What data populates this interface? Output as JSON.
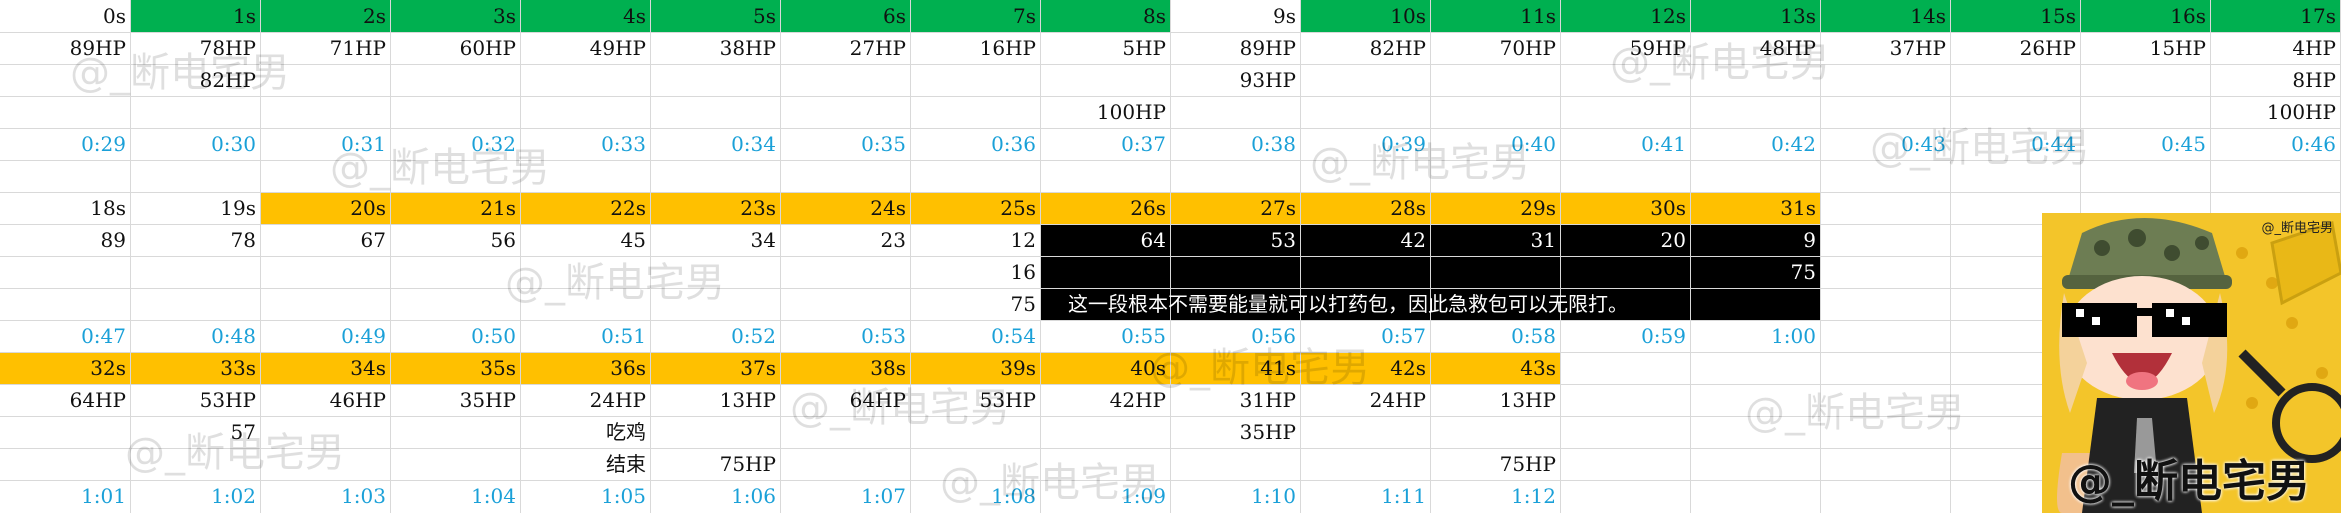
{
  "sheet": {
    "time_color": "#1aa0d8",
    "green": "#00b050",
    "orange": "#ffc000",
    "black": "#000000",
    "rows": [
      [
        {
          "c": 0,
          "t": "0s"
        },
        {
          "c": 1,
          "t": "1s"
        },
        {
          "c": 2,
          "t": "2s"
        },
        {
          "c": 3,
          "t": "3s"
        },
        {
          "c": 4,
          "t": "4s"
        },
        {
          "c": 5,
          "t": "5s"
        },
        {
          "c": 6,
          "t": "6s"
        },
        {
          "c": 7,
          "t": "7s"
        },
        {
          "c": 8,
          "t": "8s"
        },
        {
          "c": 9,
          "t": "9s"
        },
        {
          "c": 10,
          "t": "10s"
        },
        {
          "c": 11,
          "t": "11s"
        },
        {
          "c": 12,
          "t": "12s"
        },
        {
          "c": 13,
          "t": "13s"
        },
        {
          "c": 14,
          "t": "14s"
        },
        {
          "c": 15,
          "t": "15s"
        },
        {
          "c": 16,
          "t": "16s"
        },
        {
          "c": 17,
          "t": "17s"
        }
      ],
      [
        {
          "c": 0,
          "t": "89HP"
        },
        {
          "c": 1,
          "t": "78HP"
        },
        {
          "c": 2,
          "t": "71HP"
        },
        {
          "c": 3,
          "t": "60HP"
        },
        {
          "c": 4,
          "t": "49HP"
        },
        {
          "c": 5,
          "t": "38HP"
        },
        {
          "c": 6,
          "t": "27HP"
        },
        {
          "c": 7,
          "t": "16HP"
        },
        {
          "c": 8,
          "t": "5HP"
        },
        {
          "c": 9,
          "t": "89HP"
        },
        {
          "c": 10,
          "t": "82HP"
        },
        {
          "c": 11,
          "t": "70HP"
        },
        {
          "c": 12,
          "t": "59HP"
        },
        {
          "c": 13,
          "t": "48HP"
        },
        {
          "c": 14,
          "t": "37HP"
        },
        {
          "c": 15,
          "t": "26HP"
        },
        {
          "c": 16,
          "t": "15HP"
        },
        {
          "c": 17,
          "t": "4HP"
        }
      ],
      [
        {
          "c": 1,
          "t": "82HP"
        },
        {
          "c": 9,
          "t": "93HP"
        },
        {
          "c": 17,
          "t": "8HP"
        }
      ],
      [
        {
          "c": 8,
          "t": "100HP"
        },
        {
          "c": 17,
          "t": "100HP"
        }
      ],
      [
        {
          "c": 0,
          "t": "0:29",
          "time": true
        },
        {
          "c": 1,
          "t": "0:30",
          "time": true
        },
        {
          "c": 2,
          "t": "0:31",
          "time": true
        },
        {
          "c": 3,
          "t": "0:32",
          "time": true
        },
        {
          "c": 4,
          "t": "0:33",
          "time": true
        },
        {
          "c": 5,
          "t": "0:34",
          "time": true
        },
        {
          "c": 6,
          "t": "0:35",
          "time": true
        },
        {
          "c": 7,
          "t": "0:36",
          "time": true
        },
        {
          "c": 8,
          "t": "0:37",
          "time": true
        },
        {
          "c": 9,
          "t": "0:38",
          "time": true
        },
        {
          "c": 10,
          "t": "0:39",
          "time": true
        },
        {
          "c": 11,
          "t": "0:40",
          "time": true
        },
        {
          "c": 12,
          "t": "0:41",
          "time": true
        },
        {
          "c": 13,
          "t": "0:42",
          "time": true
        },
        {
          "c": 14,
          "t": "0:43",
          "time": true
        },
        {
          "c": 15,
          "t": "0:44",
          "time": true
        },
        {
          "c": 16,
          "t": "0:45",
          "time": true
        },
        {
          "c": 17,
          "t": "0:46",
          "time": true
        }
      ],
      [],
      [
        {
          "c": 0,
          "t": "18s"
        },
        {
          "c": 1,
          "t": "19s"
        },
        {
          "c": 2,
          "t": "20s"
        },
        {
          "c": 3,
          "t": "21s"
        },
        {
          "c": 4,
          "t": "22s"
        },
        {
          "c": 5,
          "t": "23s"
        },
        {
          "c": 6,
          "t": "24s"
        },
        {
          "c": 7,
          "t": "25s"
        },
        {
          "c": 8,
          "t": "26s"
        },
        {
          "c": 9,
          "t": "27s"
        },
        {
          "c": 10,
          "t": "28s"
        },
        {
          "c": 11,
          "t": "29s"
        },
        {
          "c": 12,
          "t": "30s"
        },
        {
          "c": 13,
          "t": "31s"
        }
      ],
      [
        {
          "c": 0,
          "t": "89"
        },
        {
          "c": 1,
          "t": "78"
        },
        {
          "c": 2,
          "t": "67"
        },
        {
          "c": 3,
          "t": "56"
        },
        {
          "c": 4,
          "t": "45"
        },
        {
          "c": 5,
          "t": "34"
        },
        {
          "c": 6,
          "t": "23"
        },
        {
          "c": 7,
          "t": "12"
        },
        {
          "c": 8,
          "t": "64"
        },
        {
          "c": 9,
          "t": "53"
        },
        {
          "c": 10,
          "t": "42"
        },
        {
          "c": 11,
          "t": "31"
        },
        {
          "c": 12,
          "t": "20"
        },
        {
          "c": 13,
          "t": "9"
        }
      ],
      [
        {
          "c": 7,
          "t": "16"
        },
        {
          "c": 13,
          "t": "75"
        }
      ],
      [
        {
          "c": 7,
          "t": "75"
        }
      ],
      [
        {
          "c": 0,
          "t": "0:47",
          "time": true
        },
        {
          "c": 1,
          "t": "0:48",
          "time": true
        },
        {
          "c": 2,
          "t": "0:49",
          "time": true
        },
        {
          "c": 3,
          "t": "0:50",
          "time": true
        },
        {
          "c": 4,
          "t": "0:51",
          "time": true
        },
        {
          "c": 5,
          "t": "0:52",
          "time": true
        },
        {
          "c": 6,
          "t": "0:53",
          "time": true
        },
        {
          "c": 7,
          "t": "0:54",
          "time": true
        },
        {
          "c": 8,
          "t": "0:55",
          "time": true
        },
        {
          "c": 9,
          "t": "0:56",
          "time": true
        },
        {
          "c": 10,
          "t": "0:57",
          "time": true
        },
        {
          "c": 11,
          "t": "0:58",
          "time": true
        },
        {
          "c": 12,
          "t": "0:59",
          "time": true
        },
        {
          "c": 13,
          "t": "1:00",
          "time": true
        }
      ],
      [
        {
          "c": 0,
          "t": "32s"
        },
        {
          "c": 1,
          "t": "33s"
        },
        {
          "c": 2,
          "t": "34s"
        },
        {
          "c": 3,
          "t": "35s"
        },
        {
          "c": 4,
          "t": "36s"
        },
        {
          "c": 5,
          "t": "37s"
        },
        {
          "c": 6,
          "t": "38s"
        },
        {
          "c": 7,
          "t": "39s"
        },
        {
          "c": 8,
          "t": "40s"
        },
        {
          "c": 9,
          "t": "41s"
        },
        {
          "c": 10,
          "t": "42s"
        },
        {
          "c": 11,
          "t": "43s"
        }
      ],
      [
        {
          "c": 0,
          "t": "64HP"
        },
        {
          "c": 1,
          "t": "53HP"
        },
        {
          "c": 2,
          "t": "46HP"
        },
        {
          "c": 3,
          "t": "35HP"
        },
        {
          "c": 4,
          "t": "24HP"
        },
        {
          "c": 5,
          "t": "13HP"
        },
        {
          "c": 6,
          "t": "64HP"
        },
        {
          "c": 7,
          "t": "53HP"
        },
        {
          "c": 8,
          "t": "42HP"
        },
        {
          "c": 9,
          "t": "31HP"
        },
        {
          "c": 10,
          "t": "24HP"
        },
        {
          "c": 11,
          "t": "13HP"
        }
      ],
      [
        {
          "c": 1,
          "t": "57"
        },
        {
          "c": 4,
          "t": "吃鸡"
        },
        {
          "c": 9,
          "t": "35HP"
        }
      ],
      [
        {
          "c": 4,
          "t": "结束"
        },
        {
          "c": 5,
          "t": "75HP"
        },
        {
          "c": 11,
          "t": "75HP"
        }
      ],
      [
        {
          "c": 0,
          "t": "1:01",
          "time": true
        },
        {
          "c": 1,
          "t": "1:02",
          "time": true
        },
        {
          "c": 2,
          "t": "1:03",
          "time": true
        },
        {
          "c": 3,
          "t": "1:04",
          "time": true
        },
        {
          "c": 4,
          "t": "1:05",
          "time": true
        },
        {
          "c": 5,
          "t": "1:06",
          "time": true
        },
        {
          "c": 6,
          "t": "1:07",
          "time": true
        },
        {
          "c": 7,
          "t": "1:08",
          "time": true
        },
        {
          "c": 8,
          "t": "1:09",
          "time": true
        },
        {
          "c": 9,
          "t": "1:10",
          "time": true
        },
        {
          "c": 10,
          "t": "1:11",
          "time": true
        },
        {
          "c": 11,
          "t": "1:12",
          "time": true
        }
      ]
    ],
    "note": "这一段根本不需要能量就可以打药包，因此急救包可以无限打。",
    "watermark": "@_断电宅男",
    "avatar_tag": "@_断电宅男",
    "avatar_big": "@_断电宅男"
  }
}
